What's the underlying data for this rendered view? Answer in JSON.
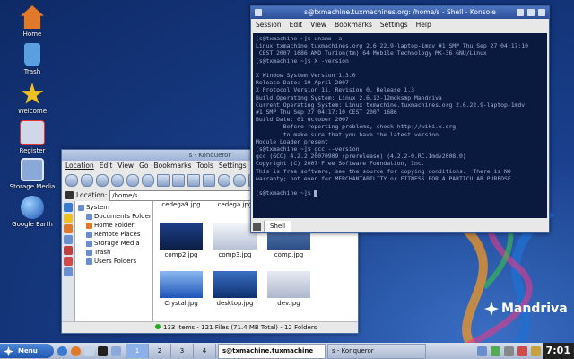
{
  "desktop": {
    "icons": [
      {
        "label": "Home",
        "icon": "home-icon",
        "color": "#e07a2a"
      },
      {
        "label": "Trash",
        "icon": "trash-icon",
        "color": "#5a9fe0"
      },
      {
        "label": "Welcome",
        "icon": "star-icon",
        "color": "#f0c020"
      },
      {
        "label": "Register",
        "icon": "register-icon",
        "color": "#d0d8e8"
      },
      {
        "label": "Storage Media",
        "icon": "monitor-icon",
        "color": "#8aa8d8"
      },
      {
        "label": "Google Earth",
        "icon": "globe-icon",
        "color": "#3a7ad0"
      }
    ],
    "brand": "Mandriva"
  },
  "konsole": {
    "title": "s@txmachine.tuxmachines.org: /home/s - Shell - Konsole",
    "menu": [
      "Session",
      "Edit",
      "View",
      "Bookmarks",
      "Settings",
      "Help"
    ],
    "terminal": "[s@txmachine ~]$ uname -a\nLinux txmachine.tuxmachines.org 2.6.22.9-laptop-1mdv #1 SMP Thu Sep 27 04:17:10\n CEST 2007 i686 AMD Turion(tm) 64 Mobile Technology MK-36 GNU/Linux\n[s@txmachine ~]$ X -version\n\nX Window System Version 1.3.0\nRelease Date: 19 April 2007\nX Protocol Version 11, Revision 0, Release 1.3\nBuild Operating System: Linux_2.6.12-12mdksmp Mandriva\nCurrent Operating System: Linux txmachine.tuxmachines.org 2.6.22.9-laptop-1mdv\n#1 SMP Thu Sep 27 04:17:10 CEST 2007 i686\nBuild Date: 01 October 2007\n        Before reporting problems, check http://wiki.x.org\n        to make sure that you have the latest version.\nModule Loader present\n[s@txmachine ~]$ gcc --version\ngcc (GCC) 4.2.2 20070909 (prerelease) (4.2.2-0.RC.1mdv2008.0)\nCopyright (C) 2007 Free Software Foundation, Inc.\nThis is free software; see the source for copying conditions.  There is NO\nwarranty; not even for MERCHANTABILITY or FITNESS FOR A PARTICULAR PURPOSE.\n\n[s@txmachine ~]$ ",
    "tab": "Shell"
  },
  "konqueror": {
    "title": "s - Konqueror",
    "menu": [
      "Location",
      "Edit",
      "View",
      "Go",
      "Bookmarks",
      "Tools",
      "Settings",
      "W"
    ],
    "location_label": "Location:",
    "location_value": "/home/s",
    "tree": [
      {
        "label": "System",
        "child": false
      },
      {
        "label": "Documents Folder",
        "child": true
      },
      {
        "label": "Home Folder",
        "child": true
      },
      {
        "label": "Remote Places",
        "child": true
      },
      {
        "label": "Storage Media",
        "child": true
      },
      {
        "label": "Trash",
        "child": true
      },
      {
        "label": "Users Folders",
        "child": true
      }
    ],
    "files": [
      {
        "name": "cedega9.jpg",
        "thumb": "#ffffff"
      },
      {
        "name": "cedega.jpg",
        "thumb": "#ffffff"
      },
      {
        "name": "comp2.jpg",
        "thumb": "#1d3f8a"
      },
      {
        "name": "comp3.jpg",
        "thumb": "#d8dde8"
      },
      {
        "name": "comp.jpg",
        "thumb": "#2e4f86"
      },
      {
        "name": "Crystal.jpg",
        "thumb": "#3b7ee0"
      },
      {
        "name": "desktop.jpg",
        "thumb": "#2a5cb8"
      },
      {
        "name": "dev.jpg",
        "thumb": "#cfd6e4"
      }
    ],
    "status": "133 Items - 121 Files (71.4 MB Total) - 12 Folders"
  },
  "taskbar": {
    "menu_label": "Menu",
    "pager": [
      "1",
      "2",
      "3",
      "4"
    ],
    "active_desktop": "1",
    "tasks": [
      {
        "label": "s@txmachine.tuxmachine",
        "active": true
      },
      {
        "label": "s - Konqueror",
        "active": false
      }
    ],
    "clock": "7:01"
  }
}
